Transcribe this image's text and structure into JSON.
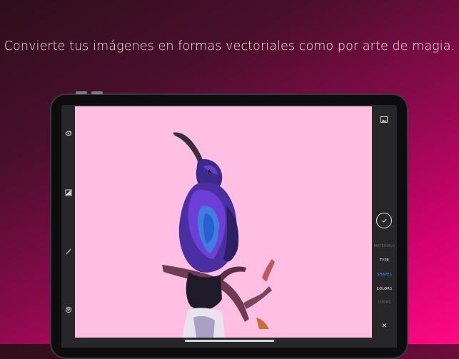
{
  "headline": "Convierte tus imágenes en formas vectoriales como por arte de magia.",
  "colors": {
    "accent_active": "#3d8cff",
    "canvas_background": "#ffbfe2",
    "panel_background": "#27272a"
  },
  "left_toolbar": {
    "tools": [
      {
        "icon": "layers-edit-icon"
      },
      {
        "icon": "image-adjust-icon"
      },
      {
        "icon": "magic-wand-icon"
      },
      {
        "icon": "color-palette-icon"
      }
    ]
  },
  "right_panel": {
    "top_icon": "image-icon",
    "confirm_icon": "checkmark-icon",
    "menu": [
      {
        "label": "MATERIALS",
        "state": "dim"
      },
      {
        "label": "TYPE",
        "state": "normal"
      },
      {
        "label": "SHAPES",
        "state": "active"
      },
      {
        "label": "COLORS",
        "state": "normal"
      },
      {
        "label": "LOOKS",
        "state": "dim"
      }
    ],
    "close_label": "✕"
  },
  "canvas": {
    "subject": "hummingbird-vector-image"
  }
}
